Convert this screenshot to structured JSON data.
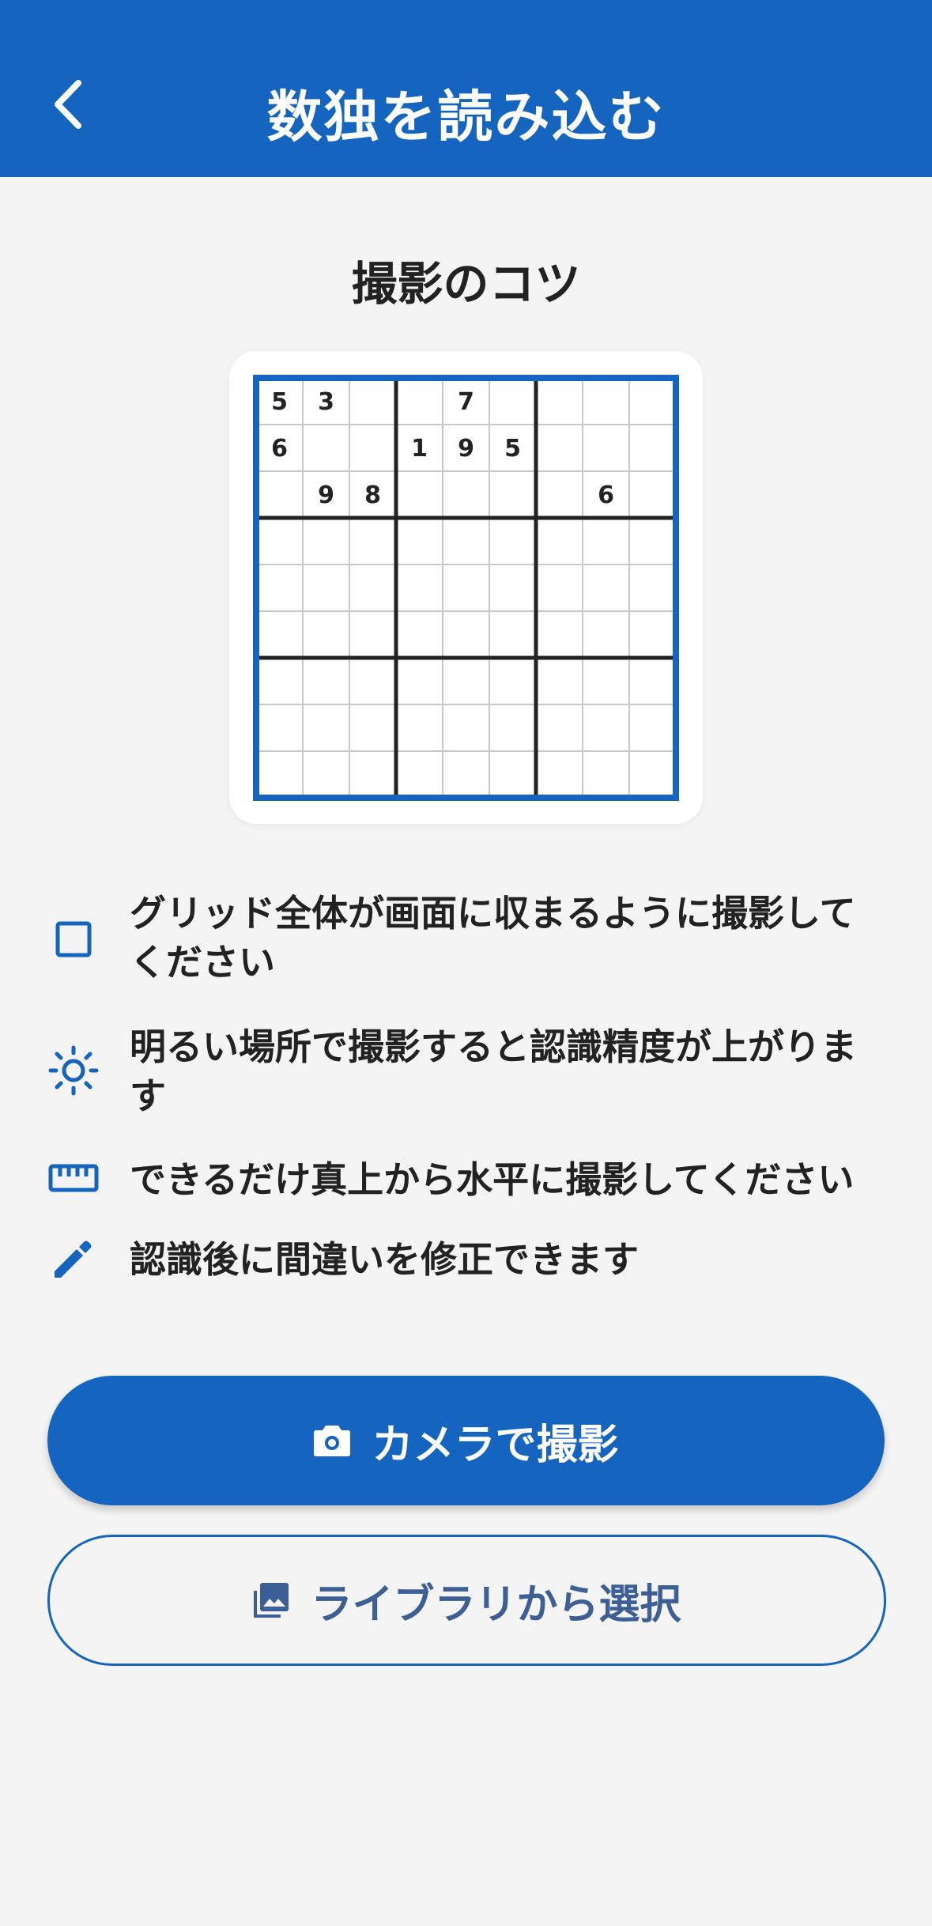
{
  "header": {
    "title": "数独を読み込む",
    "back_icon": "chevron-left-icon"
  },
  "section_title": "撮影のコツ",
  "sudoku_preview": {
    "rows": [
      [
        "5",
        "3",
        "",
        "",
        "7",
        "",
        "",
        "",
        ""
      ],
      [
        "6",
        "",
        "",
        "1",
        "9",
        "5",
        "",
        "",
        ""
      ],
      [
        "",
        "9",
        "8",
        "",
        "",
        "",
        "",
        "6",
        ""
      ],
      [
        "",
        "",
        "",
        "",
        "",
        "",
        "",
        "",
        ""
      ],
      [
        "",
        "",
        "",
        "",
        "",
        "",
        "",
        "",
        ""
      ],
      [
        "",
        "",
        "",
        "",
        "",
        "",
        "",
        "",
        ""
      ],
      [
        "",
        "",
        "",
        "",
        "",
        "",
        "",
        "",
        ""
      ],
      [
        "",
        "",
        "",
        "",
        "",
        "",
        "",
        "",
        ""
      ],
      [
        "",
        "",
        "",
        "",
        "",
        "",
        "",
        "",
        ""
      ]
    ]
  },
  "tips": [
    {
      "icon": "square-outline-icon",
      "text": "グリッド全体が画面に収まるように撮影してください"
    },
    {
      "icon": "sun-icon",
      "text": "明るい場所で撮影すると認識精度が上がります"
    },
    {
      "icon": "ruler-icon",
      "text": "できるだけ真上から水平に撮影してください"
    },
    {
      "icon": "pencil-icon",
      "text": "認識後に間違いを修正できます"
    }
  ],
  "buttons": {
    "camera": {
      "label": "カメラで撮影",
      "icon": "camera-icon"
    },
    "library": {
      "label": "ライブラリから選択",
      "icon": "photo-library-icon"
    }
  },
  "colors": {
    "primary": "#1565c0",
    "background": "#f4f4f4",
    "secondary_text": "#3d5f96"
  }
}
